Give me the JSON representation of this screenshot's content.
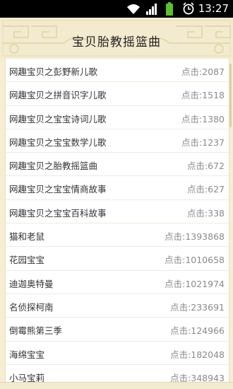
{
  "status_bar": {
    "time": "13:27",
    "icons": [
      "wifi-icon",
      "signal-icon",
      "battery-icon",
      "alarm-icon"
    ]
  },
  "header": {
    "title": "宝贝胎教摇篮曲"
  },
  "list": {
    "items": [
      {
        "name": "网趣宝贝之彭野新儿歌",
        "clicks": "点击:2087"
      },
      {
        "name": "网趣宝贝之拼音识字儿歌",
        "clicks": "点击:1518"
      },
      {
        "name": "网趣宝贝之宝宝诗词儿歌",
        "clicks": "点击:1380"
      },
      {
        "name": "网趣宝贝之宝宝数学儿歌",
        "clicks": "点击:1237"
      },
      {
        "name": "网趣宝贝之胎教摇篮曲",
        "clicks": "点击:672"
      },
      {
        "name": "网趣宝贝之宝宝情商故事",
        "clicks": "点击:627"
      },
      {
        "name": "网趣宝贝之宝宝百科故事",
        "clicks": "点击:338"
      },
      {
        "name": "猫和老鼠",
        "clicks": "点击:1393868"
      },
      {
        "name": "花园宝宝",
        "clicks": "点击:1010658"
      },
      {
        "name": "迪迦奥特曼",
        "clicks": "点击:1021974"
      },
      {
        "name": "名侦探柯南",
        "clicks": "点击:233691"
      },
      {
        "name": "倒霉熊第三季",
        "clicks": "点击:124966"
      },
      {
        "name": "海绵宝宝",
        "clicks": "点击:182048"
      },
      {
        "name": "小马宝莉",
        "clicks": "点击:348943"
      }
    ]
  }
}
